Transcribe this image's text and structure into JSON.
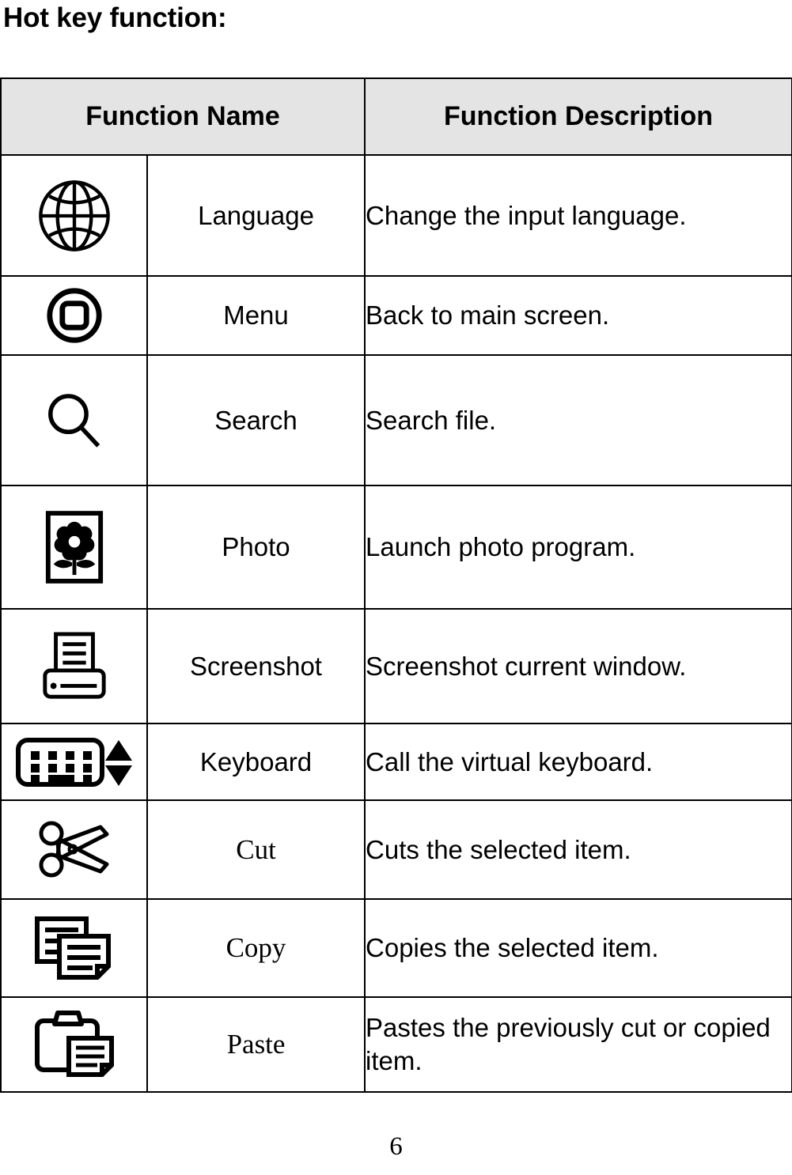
{
  "page": {
    "heading": "Hot key function:",
    "number": "6"
  },
  "table": {
    "columns": [
      {
        "key": "name",
        "label": "Function Name"
      },
      {
        "key": "description",
        "label": "Function Description"
      }
    ],
    "rows": [
      {
        "icon": "globe-icon",
        "name": "Language",
        "description": "Change the input language."
      },
      {
        "icon": "home-circle-icon",
        "name": "Menu",
        "description": "Back to main screen."
      },
      {
        "icon": "magnifier-icon",
        "name": "Search",
        "description": "Search file."
      },
      {
        "icon": "framed-flower-icon",
        "name": "Photo",
        "description": "Launch photo program."
      },
      {
        "icon": "printer-document-icon",
        "name": "Screenshot",
        "description": "Screenshot current window."
      },
      {
        "icon": "keyboard-arrows-icon",
        "name": "Keyboard",
        "description": "Call the virtual keyboard."
      },
      {
        "icon": "scissors-icon",
        "name": "Cut",
        "description": "Cuts the selected item."
      },
      {
        "icon": "documents-stack-icon",
        "name": "Copy",
        "description": "Copies the selected item."
      },
      {
        "icon": "clipboard-document-icon",
        "name": "Paste",
        "description": "Pastes the previously cut or copied item."
      }
    ]
  },
  "colors": {
    "header_background": "#e4e4e4",
    "border": "#000000",
    "text": "#000000",
    "page_background": "#ffffff"
  }
}
